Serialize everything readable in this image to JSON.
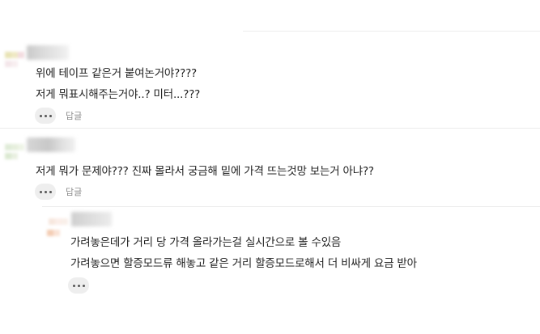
{
  "comments": [
    {
      "lines": [
        "위에 테이프 같은거 붙여논거야????",
        "저게 뭐표시해주는거야..? 미터...???"
      ],
      "reply_label": "답글",
      "more_icon": "more-dots-icon"
    },
    {
      "lines": [
        "저게 뭐가 문제야??? 진짜 몰라서 궁금해 밑에 가격 뜨는것망 보는거 아냐??"
      ],
      "reply_label": "답글",
      "more_icon": "more-dots-icon"
    }
  ],
  "reply": {
    "lines": [
      "가려놓은데가 거리 당 가격 올라가는걸 실시간으로 볼 수있음",
      "가려놓으면 할증모드류 해놓고 같은 거리 할증모드로해서 더 비싸게 요금 받아"
    ],
    "more_icon": "more-dots-icon"
  },
  "colors": {
    "text": "#202020",
    "muted": "#8a8a8a",
    "divider": "#ececec",
    "button_bg": "#eeeeee"
  }
}
